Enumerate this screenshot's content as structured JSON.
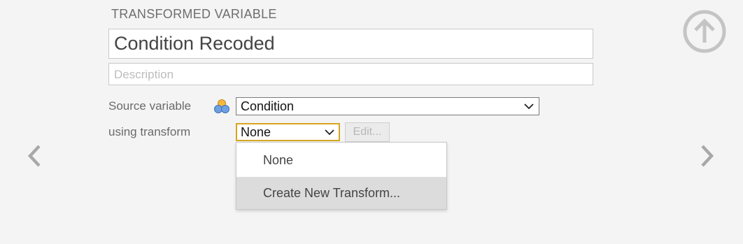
{
  "transform_panel": {
    "section_title": "TRANSFORMED VARIABLE",
    "name": "Condition Recoded",
    "description_placeholder": "Description",
    "source_label": "Source variable",
    "source_value": "Condition",
    "transform_label": "using transform",
    "transform_value": "None",
    "edit_label": "Edit...",
    "dropdown_options": [
      "None",
      "Create New Transform..."
    ]
  },
  "icons": {
    "collapse": "arrow-up-circle-icon",
    "prev": "chevron-left-icon",
    "next": "chevron-right-icon",
    "variable_type": "nominal-variable-icon"
  },
  "colors": {
    "focus_border": "#d9a520",
    "hover_bg": "#dcdcdc"
  }
}
